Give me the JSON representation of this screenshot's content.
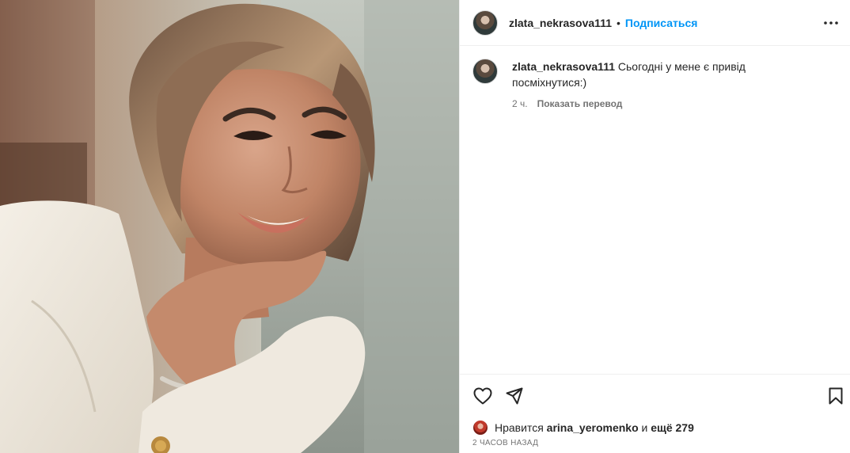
{
  "post": {
    "author": "zlata_nekrasova111",
    "separator": "•",
    "follow_label": "Подписаться",
    "more_icon": "more-horizontal-icon"
  },
  "caption": {
    "author": "zlata_nekrasova111",
    "text": "Сьогодні у мене є привід посміхнутися:)",
    "age": "2 ч.",
    "translate_label": "Показать перевод"
  },
  "actions": {
    "like_icon": "heart-icon",
    "share_icon": "paper-plane-icon",
    "save_icon": "bookmark-icon"
  },
  "likes": {
    "prefix": "Нравится",
    "user": "arina_yeromenko",
    "middle": "и",
    "others": "ещё 279"
  },
  "timestamp": "2 ЧАСОВ НАЗАД",
  "colors": {
    "link": "#0095f6",
    "text": "#262626",
    "muted": "#737373",
    "border": "#efefef"
  }
}
